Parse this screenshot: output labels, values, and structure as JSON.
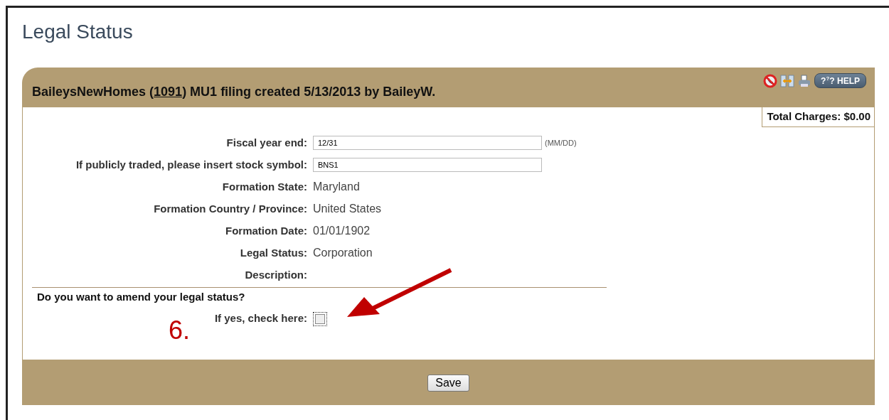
{
  "page": {
    "title": "Legal Status"
  },
  "panel": {
    "title_prefix": "BaileysNewHomes (",
    "title_link": "1091",
    "title_suffix": ") MU1 filing created 5/13/2013 by BaileyW.",
    "help_label": "?$^{?}$? HELP",
    "total_charges": "Total Charges: $0.00"
  },
  "fields": [
    {
      "kind": "input",
      "label": "Fiscal year end:",
      "value": "12/31",
      "hint": "(MM/DD)"
    },
    {
      "kind": "input",
      "label": "If publicly traded, please insert stock symbol:",
      "value": "BNS1"
    },
    {
      "kind": "text",
      "label": "Formation State:",
      "value": "Maryland"
    },
    {
      "kind": "text",
      "label": "Formation Country / Province:",
      "value": "United States"
    },
    {
      "kind": "text",
      "label": "Formation Date:",
      "value": "01/01/1902"
    },
    {
      "kind": "text",
      "label": "Legal Status:",
      "value": "Corporation"
    },
    {
      "kind": "text",
      "label": "Description:"
    }
  ],
  "amend": {
    "question": "Do you want to amend your legal status?",
    "label": "If yes, check here:",
    "checked": false
  },
  "annotation": {
    "number": "6."
  },
  "footer": {
    "save_label": "Save"
  }
}
